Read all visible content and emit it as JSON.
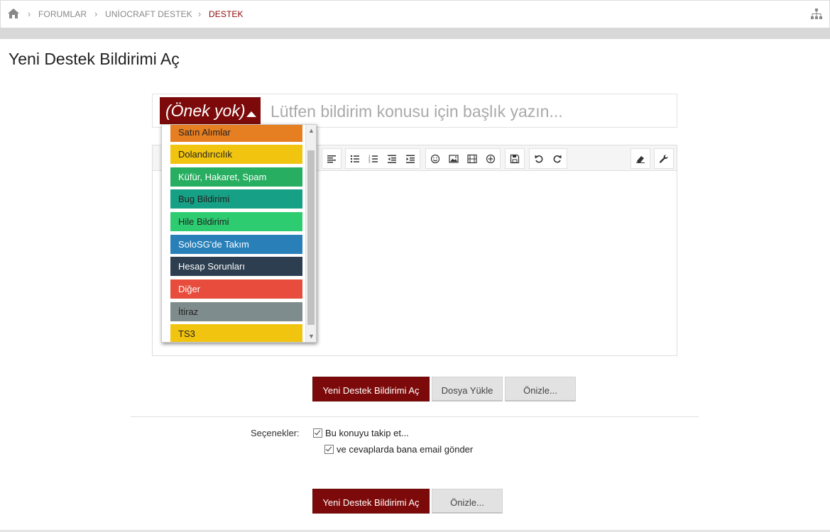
{
  "breadcrumb": {
    "items": [
      "FORUMLAR",
      "UNİOCRAFT DESTEK",
      "DESTEK"
    ]
  },
  "page": {
    "title": "Yeni Destek Bildirimi Aç"
  },
  "title_row": {
    "prefix_label": "(Önek yok)",
    "placeholder": "Lütfen bildirim konusu için başlık yazın..."
  },
  "prefix_menu": {
    "items": [
      {
        "label": "Satın Alımlar",
        "bg": "#e67e22",
        "fg": "#222222"
      },
      {
        "label": "Dolandırıcılık",
        "bg": "#f1c40f",
        "fg": "#222222"
      },
      {
        "label": "Küfür, Hakaret, Spam",
        "bg": "#27ae60",
        "fg": "#ffffff"
      },
      {
        "label": "Bug Bildirimi",
        "bg": "#16a085",
        "fg": "#222222"
      },
      {
        "label": "Hile Bildirimi",
        "bg": "#2ecc71",
        "fg": "#222222"
      },
      {
        "label": "SoloSG'de Takım",
        "bg": "#2980b9",
        "fg": "#ffffff"
      },
      {
        "label": "Hesap Sorunları",
        "bg": "#2c3e50",
        "fg": "#ffffff"
      },
      {
        "label": "Diğer",
        "bg": "#e74c3c",
        "fg": "#ffffff"
      },
      {
        "label": "İtiraz",
        "bg": "#7f8c8d",
        "fg": "#222222"
      },
      {
        "label": "TS3",
        "bg": "#f1c40f",
        "fg": "#222222"
      }
    ]
  },
  "toolbar": {
    "icons": [
      "align-left-icon",
      "bullet-list-icon",
      "numbered-list-icon",
      "outdent-icon",
      "indent-icon",
      "smiley-icon",
      "image-icon",
      "media-icon",
      "insert-icon",
      "save-draft-icon",
      "undo-icon",
      "redo-icon",
      "remove-format-icon",
      "settings-wrench-icon"
    ]
  },
  "buttons": {
    "submit": "Yeni Destek Bildirimi Aç",
    "upload": "Dosya Yükle",
    "preview": "Önizle..."
  },
  "options": {
    "label": "Seçenekler:",
    "watch_thread": "Bu konuyu takip et...",
    "email_replies": "ve cevaplarda bana email gönder"
  },
  "colors": {
    "brand": "#7d0a0a",
    "breadcrumb_current": "#8b0a0a"
  }
}
